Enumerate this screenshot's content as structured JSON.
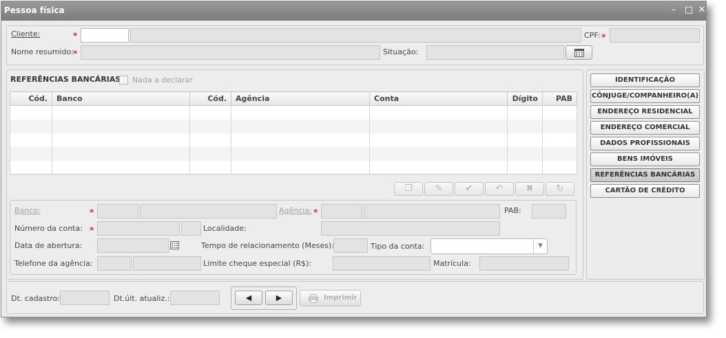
{
  "window": {
    "title": "Pessoa física",
    "minimize": "–",
    "maximize": "□",
    "close": "✕"
  },
  "client": {
    "cliente_label": "Cliente:",
    "cpf_label": "CPF:",
    "nome_resumido_label": "Nome resumido:",
    "situacao_label": "Situação:",
    "required_mark": "*"
  },
  "refs": {
    "title": "REFERÊNCIAS BANCÁRIAS",
    "nada_label": "Nada a declarar",
    "columns": [
      "Cód.",
      "Banco",
      "Cód.",
      "Agência",
      "Conta",
      "Dígito",
      "PAB"
    ]
  },
  "toolbar": {
    "new": "❐",
    "edit": "✎",
    "confirm": "✔",
    "undo": "↶",
    "delete": "✖",
    "refresh": "↻"
  },
  "form": {
    "banco_label": "Banco:",
    "agencia_label": "Agência:",
    "pab_label": "PAB:",
    "numero_conta_label": "Número da conta:",
    "localidade_label": "Localidade:",
    "data_abertura_label": "Data de abertura:",
    "tempo_label": "Tempo de relacionamento (Meses):",
    "tipo_conta_label": "Tipo da conta:",
    "telefone_label": "Telefone da agência:",
    "limite_label": "Limite cheque especial (R$):",
    "matricula_label": "Matrícula:"
  },
  "nav": [
    "IDENTIFICAÇÃO",
    "CÔNJUGE/COMPANHEIRO(A)",
    "ENDEREÇO RESIDENCIAL",
    "ENDEREÇO COMERCIAL",
    "DADOS PROFISSIONAIS",
    "BENS IMÓVEIS",
    "REFERÊNCIAS BANCÁRIAS",
    "CARTÃO DE CRÉDITO"
  ],
  "footer": {
    "dt_cadastro_label": "Dt. cadastro:",
    "dt_atualiz_label": "Dt.últ. atualiz.:",
    "prev": "◀",
    "next": "▶",
    "imprimir": "Imprimir"
  },
  "colors": {
    "required": "#c0392b",
    "titlebar": "#8a8a8a"
  }
}
